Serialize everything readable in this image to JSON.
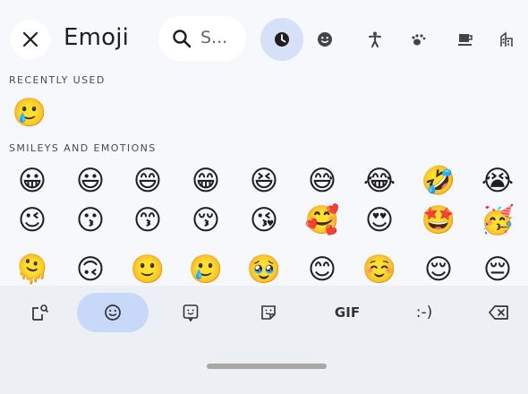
{
  "header": {
    "close_icon": "close-icon",
    "title": "Emoji",
    "search_icon": "search-icon",
    "search_placeholder": "S...",
    "categories": [
      {
        "name": "recent",
        "icon": "clock-icon",
        "selected": true
      },
      {
        "name": "smileys",
        "icon": "smiley-icon",
        "selected": false
      },
      {
        "name": "people",
        "icon": "person-icon",
        "selected": false
      },
      {
        "name": "animals",
        "icon": "paw-icon",
        "selected": false
      },
      {
        "name": "food",
        "icon": "cup-icon",
        "selected": false
      },
      {
        "name": "travel",
        "icon": "building-icon",
        "selected": false
      }
    ]
  },
  "sections": {
    "recent": {
      "label": "RECENTLY USED",
      "emojis": [
        "🥲"
      ]
    },
    "smileys": {
      "label": "SMILEYS AND EMOTIONS",
      "rows": [
        [
          "😀",
          "😃",
          "😄",
          "😁",
          "😆",
          "😅",
          "😂",
          "🤣",
          "😭"
        ],
        [
          "😉",
          "😗",
          "😙",
          "😚",
          "😘",
          "🥰",
          "😍",
          "🤩",
          "🥳"
        ],
        [
          "🫠",
          "🙃",
          "🙂",
          "🥲",
          "🥹",
          "😊",
          "☺️",
          "😌",
          "😔"
        ]
      ]
    }
  },
  "bottom_bar": {
    "items": [
      {
        "name": "sticker-search-icon",
        "label": ""
      },
      {
        "name": "emoji-icon",
        "label": "",
        "selected": true
      },
      {
        "name": "emoji-kitchen-icon",
        "label": ""
      },
      {
        "name": "sticker-icon",
        "label": ""
      },
      {
        "name": "gif-button",
        "label": "GIF"
      },
      {
        "name": "emoticon-button",
        "label": ":-)"
      },
      {
        "name": "backspace-icon",
        "label": ""
      }
    ]
  },
  "colors": {
    "background": "#f7f8fc",
    "accent": "#d6e1f7",
    "selected_tab": "#c7d8f8",
    "bottom_bar": "#eceff4"
  }
}
